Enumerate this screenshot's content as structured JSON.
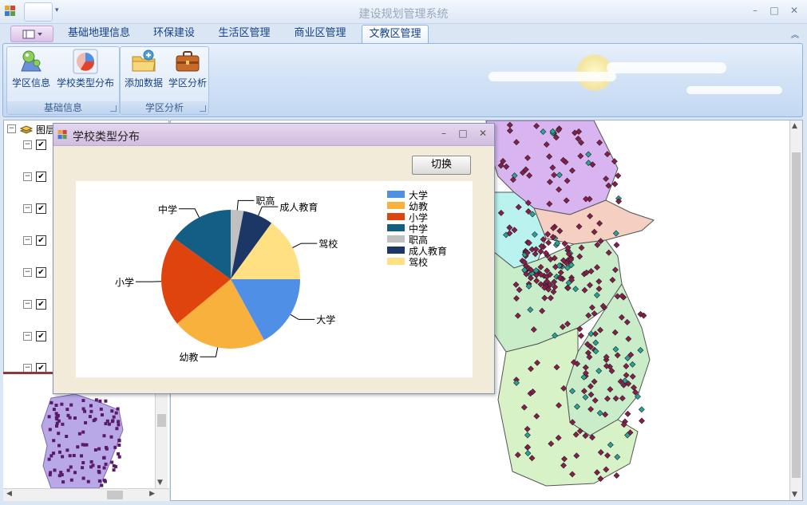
{
  "window": {
    "title": "建设规划管理系统",
    "minimize_glyph": "–",
    "maximize_glyph": "□",
    "close_glyph": "✕"
  },
  "ribbon": {
    "tabs": [
      {
        "label": "基础地理信息",
        "active": false
      },
      {
        "label": "环保建设",
        "active": false
      },
      {
        "label": "生活区管理",
        "active": false
      },
      {
        "label": "商业区管理",
        "active": false
      },
      {
        "label": "文教区管理",
        "active": true
      }
    ],
    "collapse_glyph": "⌃",
    "groups": [
      {
        "label": "基础信息",
        "buttons": [
          {
            "label": "学区信息",
            "icon": "map-pin-icon"
          },
          {
            "label": "学校类型分布",
            "icon": "pie-chart-icon"
          }
        ]
      },
      {
        "label": "学区分析",
        "buttons": [
          {
            "label": "添加数据",
            "icon": "folder-add-icon"
          },
          {
            "label": "学区分析",
            "icon": "briefcase-icon"
          }
        ]
      }
    ]
  },
  "toc": {
    "root_label": "图层",
    "check_glyph": "✔",
    "minus_glyph": "−"
  },
  "dialog": {
    "title": "学校类型分布",
    "switch_label": "切换",
    "minimize_glyph": "–",
    "maximize_glyph": "□",
    "close_glyph": "✕"
  },
  "chart_data": {
    "type": "pie",
    "title": "",
    "series": [
      {
        "name": "大学",
        "value": 17,
        "color": "#4f8fe6"
      },
      {
        "name": "幼教",
        "value": 22,
        "color": "#f8b13c"
      },
      {
        "name": "小学",
        "value": 21,
        "color": "#e0440e"
      },
      {
        "name": "中学",
        "value": 15,
        "color": "#135e84"
      },
      {
        "name": "职高",
        "value": 3,
        "color": "#c0c0c0"
      },
      {
        "name": "成人教育",
        "value": 7,
        "color": "#1c3765"
      },
      {
        "name": "驾校",
        "value": 15,
        "color": "#ffe083"
      }
    ],
    "legend": "right",
    "start_angle_deg": 0,
    "direction": "clockwise"
  },
  "colors": {
    "ribbon_accent": "#15428b",
    "dialog_title": "#d2bde0",
    "map_purple": "#d8b5f0",
    "map_green": "#c8edc8",
    "map_pink": "#f5cfc2",
    "map_cyan": "#b9f2ee",
    "point_fill": "#8a1d4c"
  }
}
